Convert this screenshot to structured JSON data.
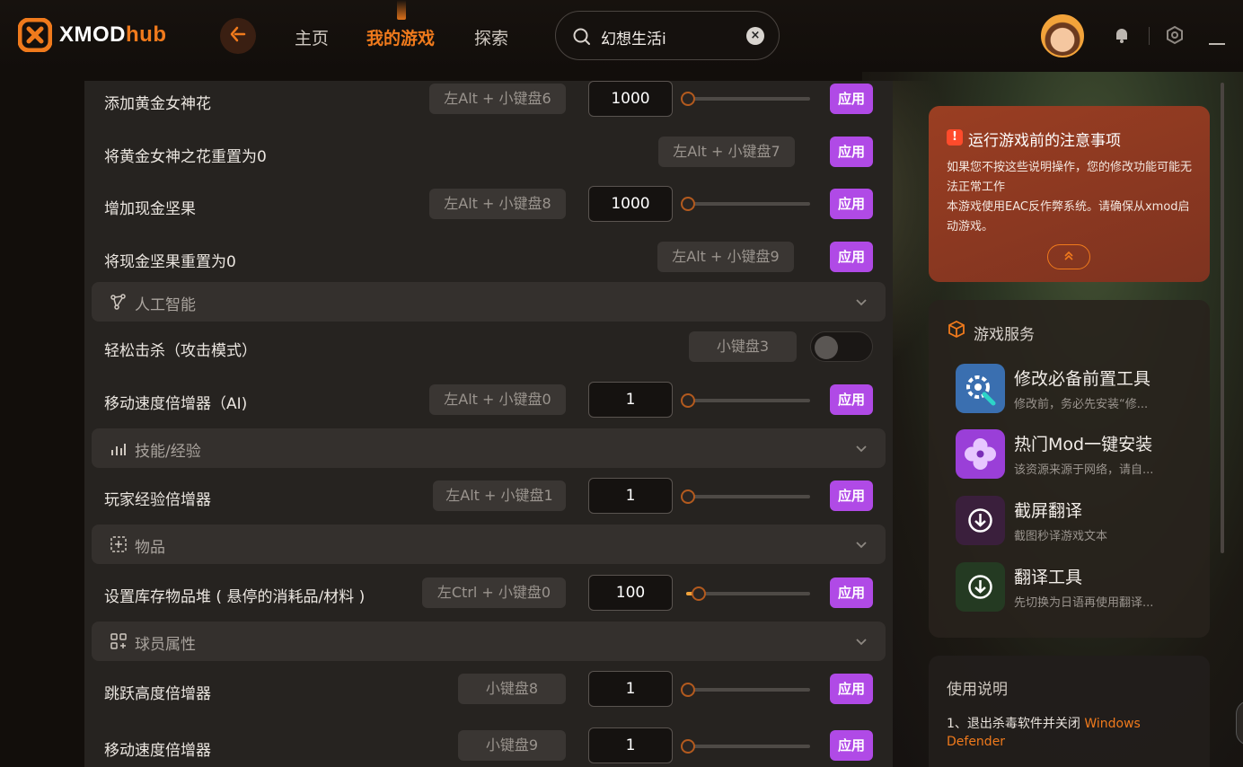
{
  "app": {
    "brand_prefix": "XMOD",
    "brand_suffix": "hub",
    "accent": "#f07a1c",
    "apply_color": "#b04ae6"
  },
  "nav": {
    "back_icon": "arrow-left-icon",
    "items": [
      {
        "label": "主页",
        "active": false
      },
      {
        "label": "我的游戏",
        "active": true
      },
      {
        "label": "探索",
        "active": false
      }
    ]
  },
  "search": {
    "value": "幻想生活i",
    "clear_label": "×"
  },
  "topbar_icons": [
    "avatar",
    "bell-icon",
    "settings-icon",
    "minimize-icon"
  ],
  "mods": {
    "apply_label": "应用",
    "rows": [
      {
        "label": "添加黄金女神花",
        "hotkey": "左Alt + 小键盘6",
        "value": "1000",
        "slider": 0.0
      },
      {
        "label": "将黄金女神之花重置为0",
        "hotkey": "左Alt + 小键盘7"
      },
      {
        "label": "增加现金坚果",
        "hotkey": "左Alt + 小键盘8",
        "value": "1000",
        "slider": 0.0
      },
      {
        "label": "将现金坚果重置为0",
        "hotkey": "左Alt + 小键盘9"
      }
    ],
    "sections": [
      {
        "title": "人工智能",
        "icon": "ai-nodes-icon",
        "rows": [
          {
            "label": "轻松击杀（攻击模式）",
            "hotkey": "小键盘3",
            "toggle": false
          },
          {
            "label": "移动速度倍增器（AI)",
            "hotkey": "左Alt + 小键盘0",
            "value": "1",
            "slider": 0.0
          }
        ]
      },
      {
        "title": "技能/经验",
        "icon": "bar-chart-icon",
        "rows": [
          {
            "label": "玩家经验倍增器",
            "hotkey": "左Alt + 小键盘1",
            "value": "1",
            "slider": 0.0
          }
        ]
      },
      {
        "title": "物品",
        "icon": "box-plus-icon",
        "rows": [
          {
            "label": "设置库存物品堆 ( 悬停的消耗品/材料 )",
            "hotkey": "左Ctrl + 小键盘0",
            "value": "100",
            "slider": 0.1
          }
        ]
      },
      {
        "title": "球员属性",
        "icon": "grid-plus-icon",
        "rows": [
          {
            "label": "跳跃高度倍增器",
            "hotkey": "小键盘8",
            "value": "1",
            "slider": 0.0
          },
          {
            "label": "移动速度倍增器",
            "hotkey": "小键盘9",
            "value": "1",
            "slider": 0.0
          }
        ]
      }
    ]
  },
  "notice": {
    "icon": "exclamation-icon",
    "title": "运行游戏前的注意事项",
    "line1": "如果您不按这些说明操作，您的修改功能可能无法正常工作",
    "line2": "本游戏使用EAC反作弊系统。请确保从xmod启动游戏。",
    "collapse_icon": "chevron-double-up-icon"
  },
  "services": {
    "title": "游戏服务",
    "items": [
      {
        "name": "修改必备前置工具",
        "desc": "修改前，务必先安装“修...",
        "icon": "gear-wrench-icon"
      },
      {
        "name": "热门Mod一键安装",
        "desc": "该资源来源于网络，请自...",
        "icon": "flower-icon"
      },
      {
        "name": "截屏翻译",
        "desc": "截图秒译游戏文本",
        "icon": "download-icon"
      },
      {
        "name": "翻译工具",
        "desc": "先切换为日语再使用翻译...",
        "icon": "download-icon"
      }
    ]
  },
  "usage": {
    "title": "使用说明",
    "step1_prefix": "1、退出杀毒软件并关闭 ",
    "step1_highlight": "Windows Defender"
  }
}
